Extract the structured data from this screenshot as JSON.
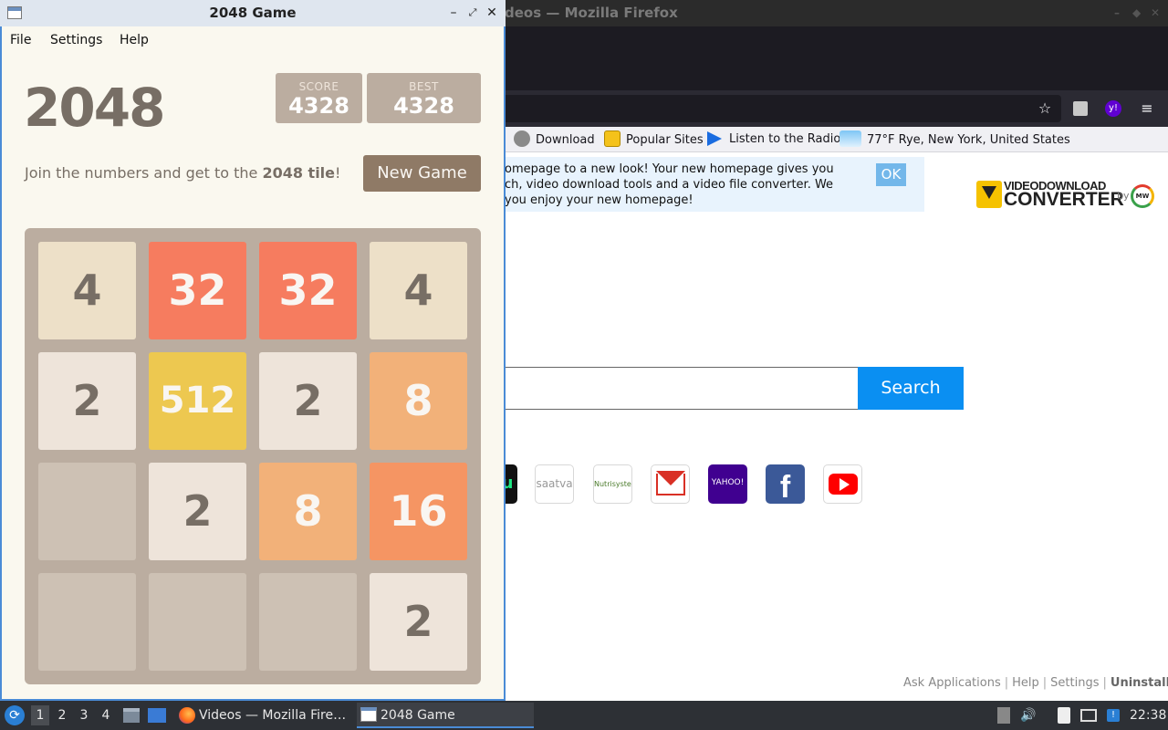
{
  "firefox": {
    "title": "Videos — Mozilla Firefox",
    "title_visible": "deos — Mozilla Firefox",
    "bookmarks": [
      {
        "label": "Download",
        "icon": "download-icon"
      },
      {
        "label": "Popular Sites",
        "icon": "star-icon"
      },
      {
        "label": "Listen to the Radio",
        "icon": "play-icon"
      },
      {
        "label": "77°F Rye, New York, United States",
        "icon": "weather-icon"
      }
    ],
    "notice": {
      "line1": "omepage to a new look! Your new homepage gives you",
      "line2": "ch, video download tools and a video file converter. We",
      "line3": " you enjoy your new homepage!",
      "ok_label": "OK"
    },
    "logo": {
      "line1": "VIDEODOWNLOAD",
      "line2": "CONVERTER",
      "by": "by",
      "badge": "MW"
    },
    "search": {
      "button_label": "Search",
      "placeholder": ""
    },
    "sites": [
      {
        "label": "u"
      },
      {
        "label": "saatva"
      },
      {
        "label": "Nutrisystem"
      },
      {
        "label": "Gmail"
      },
      {
        "label": "YAHOO!"
      },
      {
        "label": "f"
      },
      {
        "label": "YouTube"
      }
    ],
    "footer": {
      "ask": "Ask Applications",
      "help": "Help",
      "settings": "Settings",
      "uninstall": "Uninstall",
      "sep": "|"
    }
  },
  "game": {
    "window_title": "2048 Game",
    "menu": [
      "File",
      "Settings",
      "Help"
    ],
    "logo": "2048",
    "score_label": "SCORE",
    "score": "4328",
    "best_label": "BEST",
    "best": "4328",
    "intro_prefix": "Join the numbers and get to the ",
    "intro_bold": "2048 tile",
    "intro_suffix": "!",
    "new_game": "New Game",
    "board": [
      [
        "4",
        "32",
        "32",
        "4"
      ],
      [
        "2",
        "512",
        "2",
        "8"
      ],
      [
        "",
        "2",
        "8",
        "16"
      ],
      [
        "",
        "",
        "",
        "2"
      ]
    ],
    "tile_colors": {
      "": {
        "bg": "#cdc1b4",
        "fg": "#776e65"
      },
      "2": {
        "bg": "#eee4da",
        "fg": "#776e65"
      },
      "4": {
        "bg": "#ede0c8",
        "fg": "#776e65"
      },
      "8": {
        "bg": "#f2b179",
        "fg": "#f9f6f2"
      },
      "16": {
        "bg": "#f59563",
        "fg": "#f9f6f2"
      },
      "32": {
        "bg": "#f67c5f",
        "fg": "#f9f6f2"
      },
      "512": {
        "bg": "#edc850",
        "fg": "#f9f6f2"
      }
    }
  },
  "taskbar": {
    "workspaces": [
      "1",
      "2",
      "3",
      "4"
    ],
    "tasks": [
      {
        "label": "Videos — Mozilla Fire…",
        "icon": "firefox-icon"
      },
      {
        "label": "2048 Game",
        "icon": "window-icon"
      }
    ],
    "clock": "22:38"
  }
}
